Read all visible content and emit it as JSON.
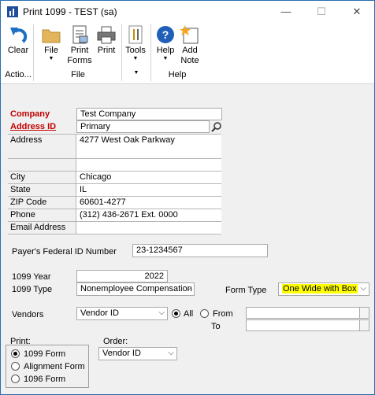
{
  "window": {
    "title": "Print 1099  -  TEST (sa)",
    "minimize": "—",
    "maximize": "☐",
    "close": "✕"
  },
  "ribbon": {
    "clear": "Clear",
    "file": "File",
    "print_forms_1": "Print",
    "print_forms_2": "Forms",
    "print": "Print",
    "tools": "Tools",
    "help": "Help",
    "add_note_1": "Add",
    "add_note_2": "Note",
    "groups": {
      "actions": "Actio...",
      "file": "File",
      "tools": "",
      "help": "Help"
    }
  },
  "form": {
    "company_label": "Company",
    "company_value": "Test Company",
    "address_id_label": "Address ID",
    "address_id_value": "Primary",
    "address_label": "Address",
    "address_line1": "4277 West Oak Parkway",
    "address_line2": "",
    "address_line3": "",
    "city_label": "City",
    "city_value": "Chicago",
    "state_label": "State",
    "state_value": "IL",
    "zip_label": "ZIP Code",
    "zip_value": "60601-4277",
    "phone_label": "Phone",
    "phone_value": "(312) 436-2671  Ext. 0000",
    "email_label": "Email Address",
    "email_value": "",
    "federal_id_label": "Payer's Federal ID Number",
    "federal_id_value": "23-1234567",
    "year_label": "1099 Year",
    "year_value": "2022",
    "type_label": "1099 Type",
    "type_value": "Nonemployee Compensation",
    "form_type_label": "Form Type",
    "form_type_value": "One Wide with Box",
    "vendors_label": "Vendors",
    "vendors_value": "Vendor ID",
    "all_label": "All",
    "from_label": "From",
    "to_label": "To",
    "print_label": "Print:",
    "print_options": [
      "1099 Form",
      "Alignment Form",
      "1096 Form"
    ],
    "order_label": "Order:",
    "order_value": "Vendor ID"
  },
  "colors": {
    "required": "#c00000",
    "highlight": "#ffff00",
    "accent": "#1f4e9c"
  }
}
